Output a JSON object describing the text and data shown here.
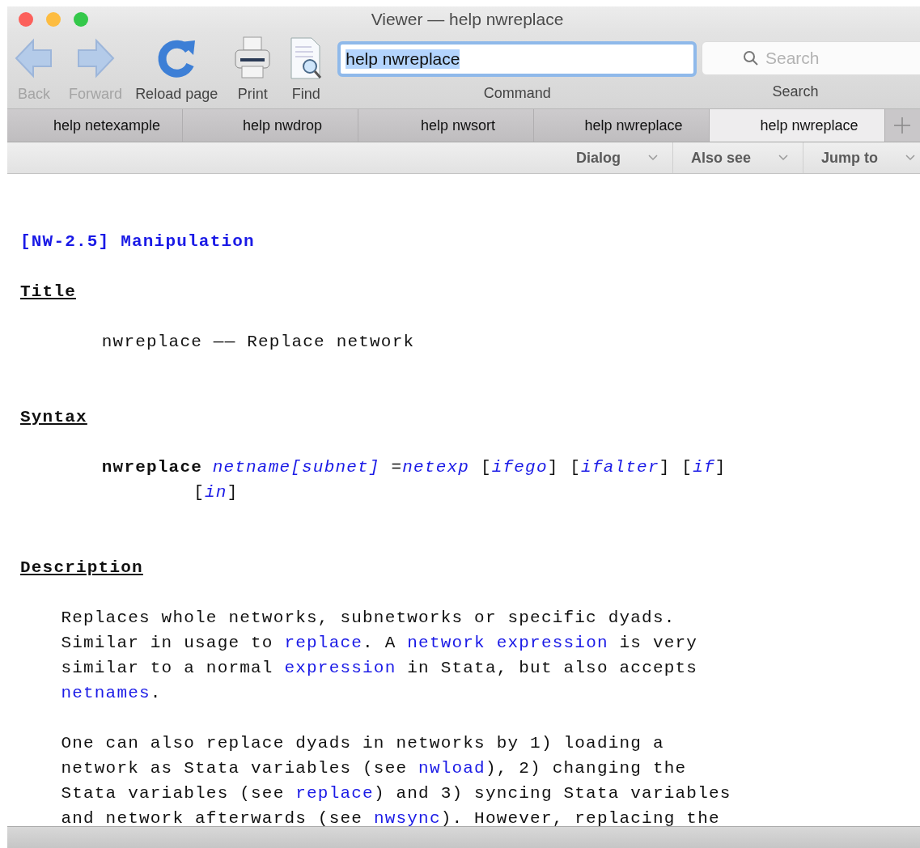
{
  "window": {
    "title": "Viewer — help nwreplace"
  },
  "toolbar": {
    "buttons": [
      {
        "kind": "back",
        "label": "Back",
        "disabled": true
      },
      {
        "kind": "forward",
        "label": "Forward",
        "disabled": true
      },
      {
        "kind": "reload",
        "label": "Reload page",
        "disabled": false
      },
      {
        "kind": "print",
        "label": "Print",
        "disabled": false
      },
      {
        "kind": "find",
        "label": "Find",
        "disabled": false
      }
    ],
    "command": {
      "label": "Command",
      "value": "help nwreplace"
    },
    "search": {
      "label": "Search",
      "placeholder": "Search"
    }
  },
  "tabs": [
    {
      "label": "help netexample",
      "selected": false
    },
    {
      "label": "help nwdrop",
      "selected": false
    },
    {
      "label": "help nwsort",
      "selected": false
    },
    {
      "label": "help nwreplace",
      "selected": false
    },
    {
      "label": "help nwreplace",
      "selected": true
    }
  ],
  "menus": [
    {
      "label": "Dialog"
    },
    {
      "label": "Also see"
    },
    {
      "label": "Jump to"
    }
  ],
  "content": {
    "heading": "[NW-2.5] Manipulation",
    "sections": [
      {
        "title": "Title",
        "paragraphs": [
          {
            "kind": "lead",
            "lines": [
              [
                {
                  "kind": "plain",
                  "text": "nwreplace —— Replace network"
                }
              ]
            ]
          }
        ]
      },
      {
        "title": "Syntax",
        "paragraphs": [
          {
            "kind": "syntax",
            "lines": [
              [
                {
                  "kind": "bold",
                  "text": "nwreplace"
                },
                {
                  "kind": "italic_link",
                  "text": "netname[subnet]"
                },
                {
                  "kind": "plain",
                  "text": " ="
                },
                {
                  "kind": "italic_link",
                  "text": "netexp"
                },
                {
                  "kind": "plain",
                  "text": " ["
                },
                {
                  "kind": "italic_link",
                  "text": "ifego"
                },
                {
                  "kind": "plain",
                  "text": "] ["
                },
                {
                  "kind": "italic_link",
                  "text": "ifalter"
                },
                {
                  "kind": "plain",
                  "text": "] ["
                },
                {
                  "kind": "italic_link",
                  "text": "if"
                },
                {
                  "kind": "plain",
                  "text": "]"
                }
              ],
              [
                {
                  "kind": "plain",
                  "text": "["
                },
                {
                  "kind": "italic_link",
                  "text": "in"
                },
                {
                  "kind": "plain",
                  "text": "]"
                }
              ]
            ]
          }
        ]
      },
      {
        "title": "Description",
        "paragraphs": [
          {
            "kind": "body",
            "lines": [
              [
                {
                  "kind": "plain",
                  "text": "Replaces whole networks, subnetworks or specific dyads."
                }
              ],
              [
                {
                  "kind": "plain",
                  "text": "Similar in usage to "
                },
                {
                  "kind": "link",
                  "text": "replace"
                },
                {
                  "kind": "plain",
                  "text": ". A "
                },
                {
                  "kind": "link",
                  "text": "network expression"
                },
                {
                  "kind": "plain",
                  "text": " is very"
                }
              ],
              [
                {
                  "kind": "plain",
                  "text": "similar to a normal "
                },
                {
                  "kind": "link",
                  "text": "expression"
                },
                {
                  "kind": "plain",
                  "text": " in Stata, but also accepts"
                }
              ],
              [
                {
                  "kind": "link",
                  "text": "netnames"
                },
                {
                  "kind": "plain",
                  "text": "."
                }
              ]
            ]
          },
          {
            "kind": "body",
            "lines": [
              [
                {
                  "kind": "plain",
                  "text": "One can also replace dyads in networks by 1) loading a"
                }
              ],
              [
                {
                  "kind": "plain",
                  "text": "network as Stata variables (see "
                },
                {
                  "kind": "link",
                  "text": "nwload"
                },
                {
                  "kind": "plain",
                  "text": "), 2) changing the"
                }
              ],
              [
                {
                  "kind": "plain",
                  "text": "Stata variables (see "
                },
                {
                  "kind": "link",
                  "text": "replace"
                },
                {
                  "kind": "plain",
                  "text": ") and 3) syncing Stata variables"
                }
              ],
              [
                {
                  "kind": "plain",
                  "text": "and network afterwards (see "
                },
                {
                  "kind": "link",
                  "text": "nwsync"
                },
                {
                  "kind": "plain",
                  "text": "). However, replacing the"
                }
              ]
            ]
          }
        ]
      }
    ]
  }
}
